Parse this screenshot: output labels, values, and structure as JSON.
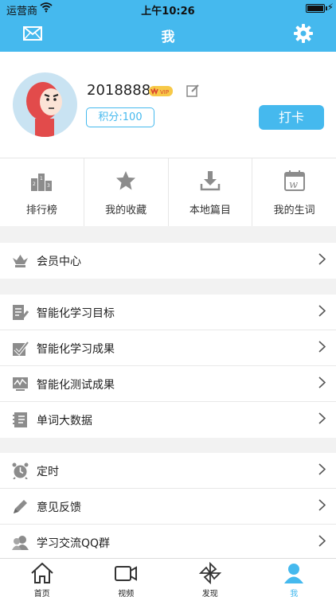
{
  "status_bar": {
    "carrier": "运营商",
    "time": "上午10:26"
  },
  "navbar": {
    "title": "我"
  },
  "profile": {
    "username": "2018888",
    "vip_badge": "VIP",
    "points": "积分:100",
    "checkin_label": "打卡"
  },
  "quick_links": [
    {
      "label": "排行榜",
      "icon": "podium-icon"
    },
    {
      "label": "我的收藏",
      "icon": "star-icon"
    },
    {
      "label": "本地篇目",
      "icon": "download-icon"
    },
    {
      "label": "我的生词",
      "icon": "word-calendar-icon"
    }
  ],
  "menu_groups": [
    [
      {
        "label": "会员中心",
        "icon": "crown-icon"
      }
    ],
    [
      {
        "label": "智能化学习目标",
        "icon": "document-edit-icon"
      },
      {
        "label": "智能化学习成果",
        "icon": "checkbox-icon"
      },
      {
        "label": "智能化测试成果",
        "icon": "chart-icon"
      },
      {
        "label": "单词大数据",
        "icon": "notebook-icon"
      }
    ],
    [
      {
        "label": "定时",
        "icon": "alarm-clock-icon"
      },
      {
        "label": "意见反馈",
        "icon": "pencil-icon"
      },
      {
        "label": "学习交流QQ群",
        "icon": "group-icon"
      }
    ]
  ],
  "tab_bar": [
    {
      "label": "首页",
      "icon": "home-icon"
    },
    {
      "label": "视频",
      "icon": "video-icon"
    },
    {
      "label": "发现",
      "icon": "pinwheel-icon"
    },
    {
      "label": "我",
      "icon": "user-icon"
    }
  ],
  "colors": {
    "accent": "#45b9ee",
    "icon_gray": "#8c8c8c"
  }
}
